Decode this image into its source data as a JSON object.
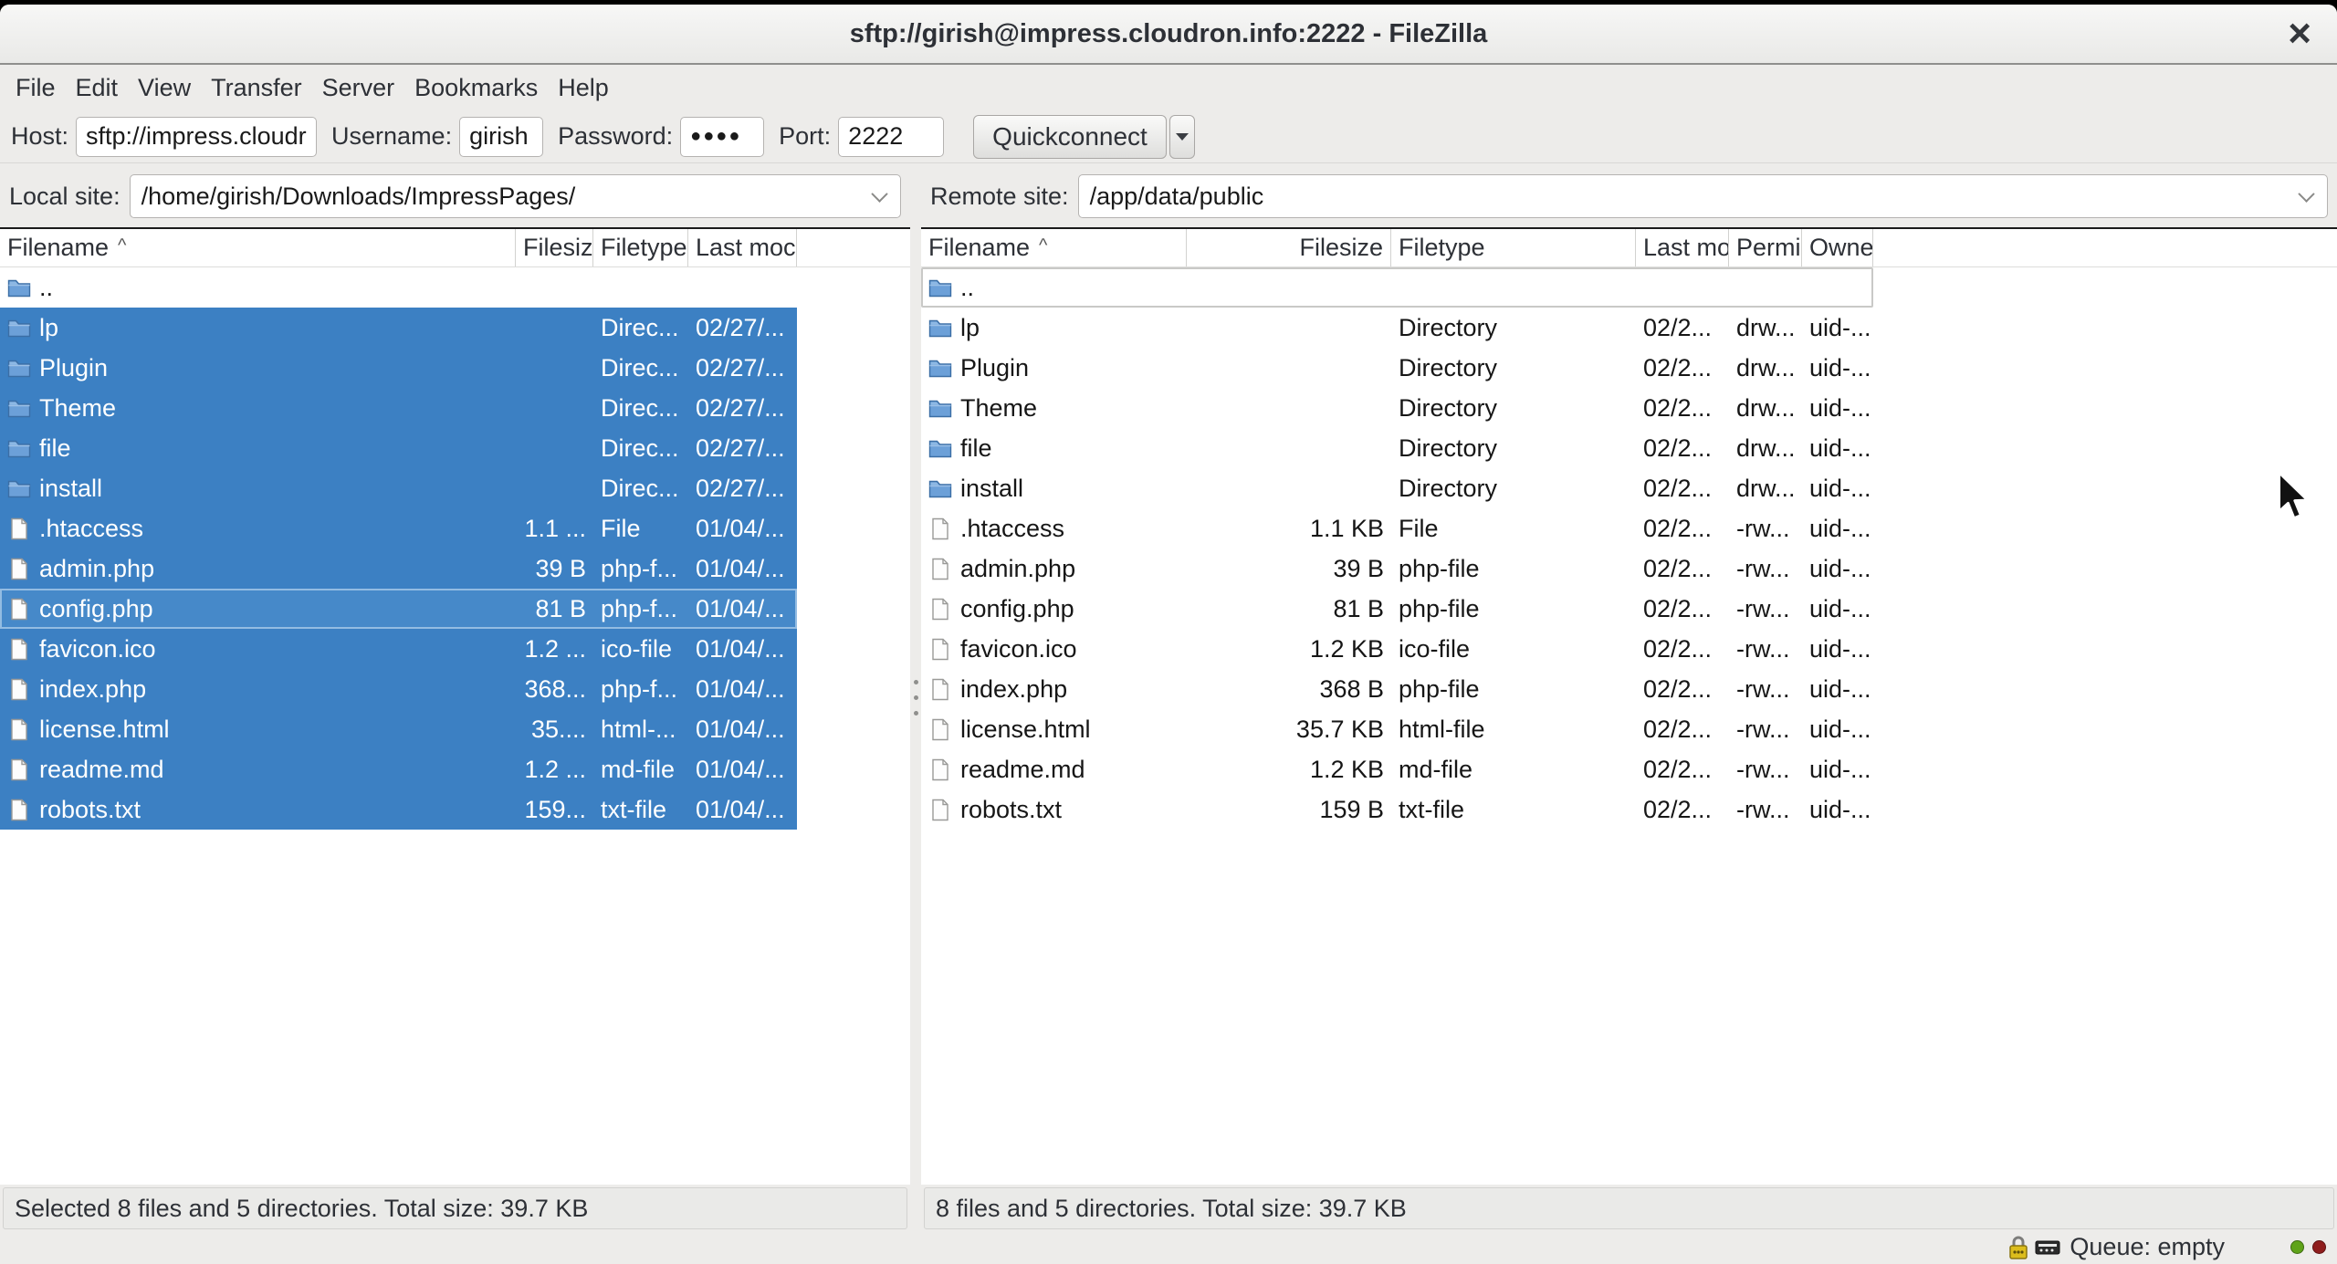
{
  "window": {
    "title": "sftp://girish@impress.cloudron.info:2222 - FileZilla",
    "close_glyph": "×"
  },
  "menu": {
    "items": [
      "File",
      "Edit",
      "View",
      "Transfer",
      "Server",
      "Bookmarks",
      "Help"
    ]
  },
  "quickconnect": {
    "host_label": "Host:",
    "host_value": "sftp://impress.cloudr",
    "username_label": "Username:",
    "username_value": "girish",
    "password_label": "Password:",
    "password_value": "●●●●",
    "port_label": "Port:",
    "port_value": "2222",
    "button_label": "Quickconnect"
  },
  "panels": {
    "local": {
      "site_label": "Local site:",
      "site_path": "/home/girish/Downloads/ImpressPages/",
      "sort_indicator": "^",
      "columns": [
        "Filename",
        "Filesiz",
        "Filetype",
        "Last moc"
      ],
      "rows": [
        {
          "name": "..",
          "icon": "folder-icon",
          "size": "",
          "type": "",
          "modified": "",
          "selected": false,
          "focused": false
        },
        {
          "name": "lp",
          "icon": "folder-icon",
          "size": "",
          "type": "Direc...",
          "modified": "02/27/...",
          "selected": true,
          "focused": false
        },
        {
          "name": "Plugin",
          "icon": "folder-icon",
          "size": "",
          "type": "Direc...",
          "modified": "02/27/...",
          "selected": true,
          "focused": false
        },
        {
          "name": "Theme",
          "icon": "folder-icon",
          "size": "",
          "type": "Direc...",
          "modified": "02/27/...",
          "selected": true,
          "focused": false
        },
        {
          "name": "file",
          "icon": "folder-icon",
          "size": "",
          "type": "Direc...",
          "modified": "02/27/...",
          "selected": true,
          "focused": false
        },
        {
          "name": "install",
          "icon": "folder-icon",
          "size": "",
          "type": "Direc...",
          "modified": "02/27/...",
          "selected": true,
          "focused": false
        },
        {
          "name": ".htaccess",
          "icon": "file-icon",
          "size": "1.1 ...",
          "type": "File",
          "modified": "01/04/...",
          "selected": true,
          "focused": false
        },
        {
          "name": "admin.php",
          "icon": "file-icon",
          "size": "39 B",
          "type": "php-f...",
          "modified": "01/04/...",
          "selected": true,
          "focused": false
        },
        {
          "name": "config.php",
          "icon": "file-icon",
          "size": "81 B",
          "type": "php-f...",
          "modified": "01/04/...",
          "selected": true,
          "focused": true
        },
        {
          "name": "favicon.ico",
          "icon": "file-icon",
          "size": "1.2 ...",
          "type": "ico-file",
          "modified": "01/04/...",
          "selected": true,
          "focused": false
        },
        {
          "name": "index.php",
          "icon": "file-icon",
          "size": "368...",
          "type": "php-f...",
          "modified": "01/04/...",
          "selected": true,
          "focused": false
        },
        {
          "name": "license.html",
          "icon": "file-icon",
          "size": "35....",
          "type": "html-...",
          "modified": "01/04/...",
          "selected": true,
          "focused": false
        },
        {
          "name": "readme.md",
          "icon": "file-icon",
          "size": "1.2 ...",
          "type": "md-file",
          "modified": "01/04/...",
          "selected": true,
          "focused": false
        },
        {
          "name": "robots.txt",
          "icon": "file-icon",
          "size": "159...",
          "type": "txt-file",
          "modified": "01/04/...",
          "selected": true,
          "focused": false
        }
      ],
      "status": "Selected 8 files and 5 directories. Total size: 39.7 KB"
    },
    "remote": {
      "site_label": "Remote site:",
      "site_path": "/app/data/public",
      "sort_indicator": "^",
      "columns": [
        "Filename",
        "Filesize",
        "Filetype",
        "Last mo",
        "Permi",
        "Owne"
      ],
      "rows": [
        {
          "name": "..",
          "icon": "folder-icon",
          "size": "",
          "type": "",
          "modified": "",
          "perms": "",
          "owner": "",
          "selected": false,
          "focused": true
        },
        {
          "name": "lp",
          "icon": "folder-icon",
          "size": "",
          "type": "Directory",
          "modified": "02/2...",
          "perms": "drw...",
          "owner": "uid-...",
          "selected": false,
          "focused": false
        },
        {
          "name": "Plugin",
          "icon": "folder-icon",
          "size": "",
          "type": "Directory",
          "modified": "02/2...",
          "perms": "drw...",
          "owner": "uid-...",
          "selected": false,
          "focused": false
        },
        {
          "name": "Theme",
          "icon": "folder-icon",
          "size": "",
          "type": "Directory",
          "modified": "02/2...",
          "perms": "drw...",
          "owner": "uid-...",
          "selected": false,
          "focused": false
        },
        {
          "name": "file",
          "icon": "folder-icon",
          "size": "",
          "type": "Directory",
          "modified": "02/2...",
          "perms": "drw...",
          "owner": "uid-...",
          "selected": false,
          "focused": false
        },
        {
          "name": "install",
          "icon": "folder-icon",
          "size": "",
          "type": "Directory",
          "modified": "02/2...",
          "perms": "drw...",
          "owner": "uid-...",
          "selected": false,
          "focused": false
        },
        {
          "name": ".htaccess",
          "icon": "file-icon",
          "size": "1.1 KB",
          "type": "File",
          "modified": "02/2...",
          "perms": "-rw...",
          "owner": "uid-...",
          "selected": false,
          "focused": false
        },
        {
          "name": "admin.php",
          "icon": "file-icon",
          "size": "39 B",
          "type": "php-file",
          "modified": "02/2...",
          "perms": "-rw...",
          "owner": "uid-...",
          "selected": false,
          "focused": false
        },
        {
          "name": "config.php",
          "icon": "file-icon",
          "size": "81 B",
          "type": "php-file",
          "modified": "02/2...",
          "perms": "-rw...",
          "owner": "uid-...",
          "selected": false,
          "focused": false
        },
        {
          "name": "favicon.ico",
          "icon": "file-icon",
          "size": "1.2 KB",
          "type": "ico-file",
          "modified": "02/2...",
          "perms": "-rw...",
          "owner": "uid-...",
          "selected": false,
          "focused": false
        },
        {
          "name": "index.php",
          "icon": "file-icon",
          "size": "368 B",
          "type": "php-file",
          "modified": "02/2...",
          "perms": "-rw...",
          "owner": "uid-...",
          "selected": false,
          "focused": false
        },
        {
          "name": "license.html",
          "icon": "file-icon",
          "size": "35.7 KB",
          "type": "html-file",
          "modified": "02/2...",
          "perms": "-rw...",
          "owner": "uid-...",
          "selected": false,
          "focused": false
        },
        {
          "name": "readme.md",
          "icon": "file-icon",
          "size": "1.2 KB",
          "type": "md-file",
          "modified": "02/2...",
          "perms": "-rw...",
          "owner": "uid-...",
          "selected": false,
          "focused": false
        },
        {
          "name": "robots.txt",
          "icon": "file-icon",
          "size": "159 B",
          "type": "txt-file",
          "modified": "02/2...",
          "perms": "-rw...",
          "owner": "uid-...",
          "selected": false,
          "focused": false
        }
      ],
      "status": "8 files and 5 directories. Total size: 39.7 KB"
    }
  },
  "statusbar": {
    "queue_label": "Queue: empty",
    "indicator_green": "#5fa319",
    "indicator_red": "#8f1d1d"
  },
  "colors": {
    "selection_blue": "#3c80c3",
    "selection_focus_blue": "#4689c9",
    "window_bg": "#edecea",
    "chrome_text": "#2d3036"
  }
}
